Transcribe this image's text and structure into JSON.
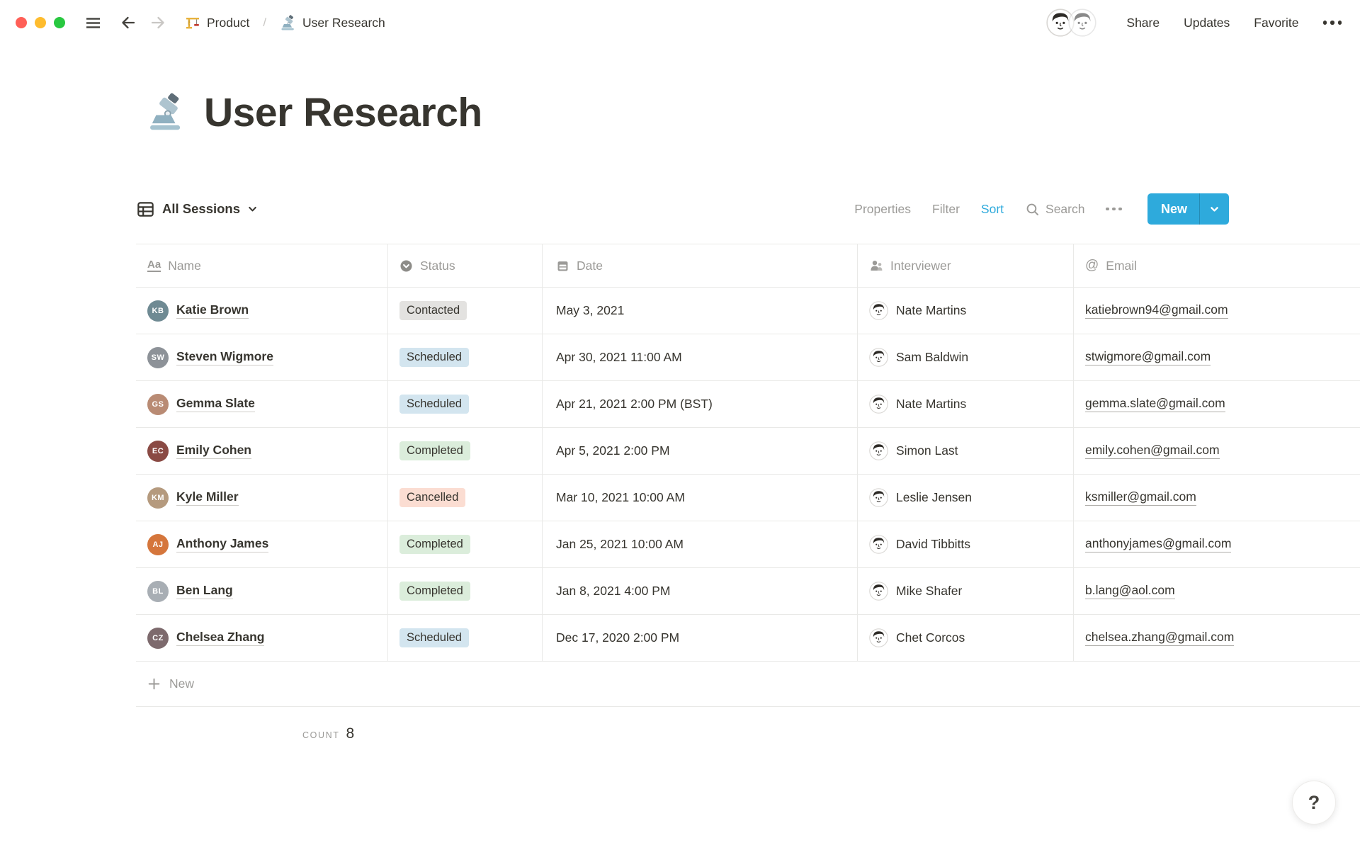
{
  "topbar": {
    "breadcrumb": [
      {
        "icon": "crane-icon",
        "label": "Product"
      },
      {
        "icon": "microscope-icon",
        "label": "User Research"
      }
    ],
    "separator": "/",
    "actions": {
      "share": "Share",
      "updates": "Updates",
      "favorite": "Favorite"
    }
  },
  "page": {
    "title": "User Research"
  },
  "view_bar": {
    "view_name": "All Sessions",
    "properties": "Properties",
    "filter": "Filter",
    "sort": "Sort",
    "search": "Search",
    "new_button": "New"
  },
  "table": {
    "columns": [
      {
        "key": "name",
        "label": "Name",
        "icon": "text-icon"
      },
      {
        "key": "status",
        "label": "Status",
        "icon": "select-icon"
      },
      {
        "key": "date",
        "label": "Date",
        "icon": "calendar-icon"
      },
      {
        "key": "interviewer",
        "label": "Interviewer",
        "icon": "person-icon"
      },
      {
        "key": "email",
        "label": "Email",
        "icon": "at-icon"
      }
    ],
    "rows": [
      {
        "name": "Katie Brown",
        "initials": "KB",
        "avatar_color": "#6f8a93",
        "status": "Contacted",
        "status_color": "gray",
        "date": "May 3, 2021",
        "interviewer": "Nate Martins",
        "email": "katiebrown94@gmail.com"
      },
      {
        "name": "Steven Wigmore",
        "initials": "SW",
        "avatar_color": "#8d9298",
        "status": "Scheduled",
        "status_color": "blue",
        "date": "Apr 30, 2021 11:00 AM",
        "interviewer": "Sam Baldwin",
        "email": "stwigmore@gmail.com"
      },
      {
        "name": "Gemma Slate",
        "initials": "GS",
        "avatar_color": "#b98b74",
        "status": "Scheduled",
        "status_color": "blue",
        "date": "Apr 21, 2021 2:00 PM (BST)",
        "interviewer": "Nate Martins",
        "email": "gemma.slate@gmail.com"
      },
      {
        "name": "Emily Cohen",
        "initials": "EC",
        "avatar_color": "#8a4a44",
        "status": "Completed",
        "status_color": "green",
        "date": "Apr 5, 2021 2:00 PM",
        "interviewer": "Simon Last",
        "email": "emily.cohen@gmail.com"
      },
      {
        "name": "Kyle Miller",
        "initials": "KM",
        "avatar_color": "#b59a7e",
        "status": "Cancelled",
        "status_color": "red",
        "date": "Mar 10, 2021 10:00 AM",
        "interviewer": "Leslie Jensen",
        "email": "ksmiller@gmail.com"
      },
      {
        "name": "Anthony James",
        "initials": "AJ",
        "avatar_color": "#d5763c",
        "status": "Completed",
        "status_color": "green",
        "date": "Jan 25, 2021 10:00 AM",
        "interviewer": "David Tibbitts",
        "email": "anthonyjames@gmail.com"
      },
      {
        "name": "Ben Lang",
        "initials": "BL",
        "avatar_color": "#a8aeb4",
        "status": "Completed",
        "status_color": "green",
        "date": "Jan 8, 2021 4:00 PM",
        "interviewer": "Mike Shafer",
        "email": "b.lang@aol.com"
      },
      {
        "name": "Chelsea Zhang",
        "initials": "CZ",
        "avatar_color": "#7d6a6d",
        "status": "Scheduled",
        "status_color": "blue",
        "date": "Dec 17, 2020 2:00 PM",
        "interviewer": "Chet Corcos",
        "email": "chelsea.zhang@gmail.com"
      }
    ],
    "new_row_label": "New",
    "count_label": "COUNT",
    "count_value": "8"
  },
  "help_button": "?",
  "colors": {
    "accent_blue": "#2EAADC",
    "badge_gray_bg": "#E3E2E0",
    "badge_blue_bg": "#D3E5EF",
    "badge_green_bg": "#DBEDDB",
    "badge_red_bg": "#FBDDD2",
    "text_dark": "#37352F",
    "text_gray": "#9B9A97"
  }
}
